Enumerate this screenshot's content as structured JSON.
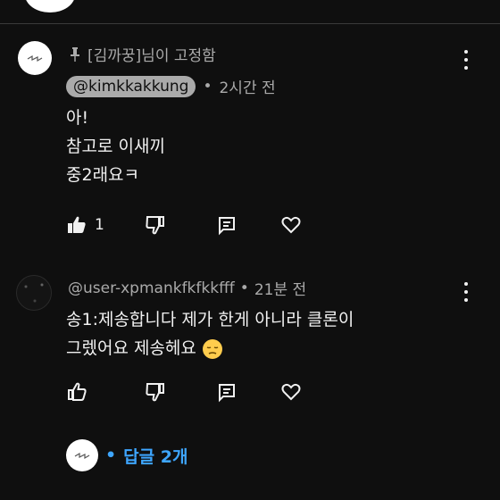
{
  "pinned_comment": {
    "pinned_by_label": "[김까꿍]님이 고정함",
    "author": "@kimkkakkung",
    "time": "2시간 전",
    "lines": [
      "아!",
      "참고로 이새끼",
      "중2래요ㅋ"
    ],
    "like_count": "1"
  },
  "reply_comment": {
    "author": "@user-xpmankfkfkkfff",
    "time": "21분 전",
    "lines": [
      "송1:제송합니다 제가 한게 아니라 클론이",
      "그렜어요 제송헤요"
    ]
  },
  "replies": {
    "label": "답글 2개"
  },
  "colors": {
    "background": "#0f0f0f",
    "text": "#f1f1f1",
    "muted": "#aaaaaa",
    "link": "#3ea6ff"
  },
  "icons": [
    "pin-icon",
    "thumb-up-icon",
    "thumb-down-icon",
    "comment-icon",
    "heart-icon",
    "more-vert-icon",
    "sad-emoji-icon"
  ]
}
